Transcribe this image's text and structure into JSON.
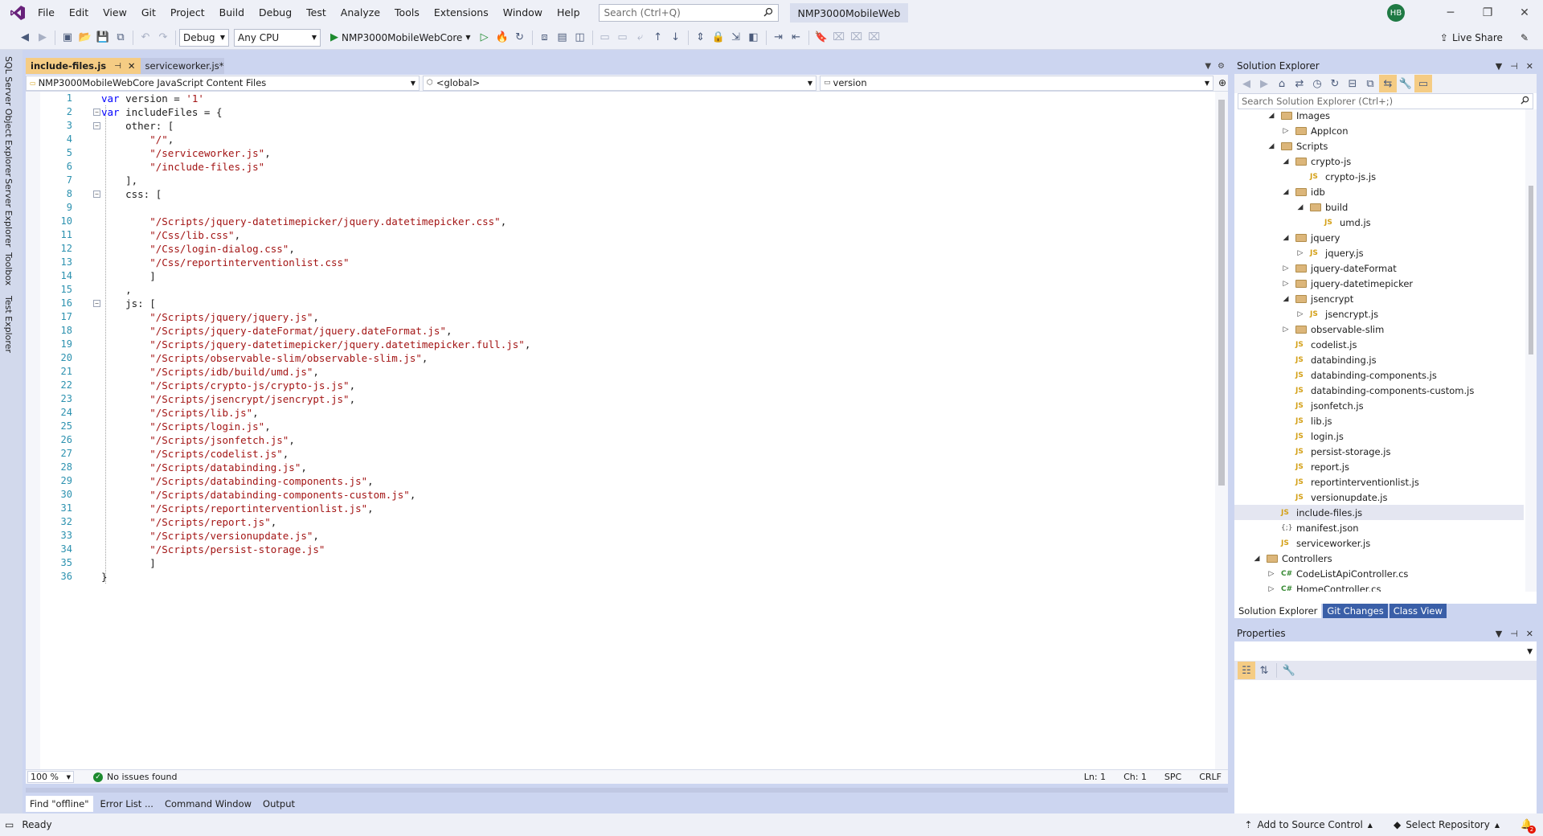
{
  "app": {
    "accent": "#68217A",
    "selected_tab_color": "#F5CC84"
  },
  "menu": {
    "items": [
      "File",
      "Edit",
      "View",
      "Git",
      "Project",
      "Build",
      "Debug",
      "Test",
      "Analyze",
      "Tools",
      "Extensions",
      "Window",
      "Help"
    ],
    "search_placeholder": "Search (Ctrl+Q)",
    "solution_name": "NMP3000MobileWeb",
    "user_initials": "HB"
  },
  "toolbar": {
    "configuration": "Debug",
    "platform": "Any CPU",
    "startup_project": "NMP3000MobileWebCore",
    "live_share": "Live Share"
  },
  "left_strip": {
    "tabs": [
      "SQL Server Object Explorer",
      "Server Explorer",
      "Toolbox",
      "Test Explorer"
    ]
  },
  "editor": {
    "tabs": [
      {
        "label": "include-files.js",
        "active": true
      },
      {
        "label": "serviceworker.js*",
        "active": false
      }
    ],
    "nav": {
      "project": "NMP3000MobileWebCore JavaScript Content Files",
      "scope": "<global>",
      "member": "version"
    },
    "lines": [
      {
        "n": "1",
        "tokens": [
          {
            "t": "var",
            "c": "kw"
          },
          {
            "t": " version = ",
            "c": "plain"
          },
          {
            "t": "'1'",
            "c": "str"
          }
        ]
      },
      {
        "n": "2",
        "fold": "−",
        "tokens": [
          {
            "t": "var",
            "c": "kw"
          },
          {
            "t": " includeFiles = {",
            "c": "plain"
          }
        ]
      },
      {
        "n": "3",
        "fold": "−",
        "tokens": [
          {
            "t": "    other: [",
            "c": "plain"
          }
        ]
      },
      {
        "n": "4",
        "tokens": [
          {
            "t": "        ",
            "c": "plain"
          },
          {
            "t": "\"/\"",
            "c": "str"
          },
          {
            "t": ",",
            "c": "plain"
          }
        ]
      },
      {
        "n": "5",
        "tokens": [
          {
            "t": "        ",
            "c": "plain"
          },
          {
            "t": "\"/serviceworker.js\"",
            "c": "str"
          },
          {
            "t": ",",
            "c": "plain"
          }
        ]
      },
      {
        "n": "6",
        "tokens": [
          {
            "t": "        ",
            "c": "plain"
          },
          {
            "t": "\"/include-files.js\"",
            "c": "str"
          }
        ]
      },
      {
        "n": "7",
        "tokens": [
          {
            "t": "    ],",
            "c": "plain"
          }
        ]
      },
      {
        "n": "8",
        "fold": "−",
        "tokens": [
          {
            "t": "    css: [",
            "c": "plain"
          }
        ]
      },
      {
        "n": "9",
        "tokens": []
      },
      {
        "n": "10",
        "tokens": [
          {
            "t": "        ",
            "c": "plain"
          },
          {
            "t": "\"/Scripts/jquery-datetimepicker/jquery.datetimepicker.css\"",
            "c": "str"
          },
          {
            "t": ",",
            "c": "plain"
          }
        ]
      },
      {
        "n": "11",
        "tokens": [
          {
            "t": "        ",
            "c": "plain"
          },
          {
            "t": "\"/Css/lib.css\"",
            "c": "str"
          },
          {
            "t": ",",
            "c": "plain"
          }
        ]
      },
      {
        "n": "12",
        "tokens": [
          {
            "t": "        ",
            "c": "plain"
          },
          {
            "t": "\"/Css/login-dialog.css\"",
            "c": "str"
          },
          {
            "t": ",",
            "c": "plain"
          }
        ]
      },
      {
        "n": "13",
        "tokens": [
          {
            "t": "        ",
            "c": "plain"
          },
          {
            "t": "\"/Css/reportinterventionlist.css\"",
            "c": "str"
          }
        ]
      },
      {
        "n": "14",
        "tokens": [
          {
            "t": "        ]",
            "c": "plain"
          }
        ]
      },
      {
        "n": "15",
        "tokens": [
          {
            "t": "    ,",
            "c": "plain"
          }
        ]
      },
      {
        "n": "16",
        "fold": "−",
        "tokens": [
          {
            "t": "    js: [",
            "c": "plain"
          }
        ]
      },
      {
        "n": "17",
        "tokens": [
          {
            "t": "        ",
            "c": "plain"
          },
          {
            "t": "\"/Scripts/jquery/jquery.js\"",
            "c": "str"
          },
          {
            "t": ",",
            "c": "plain"
          }
        ]
      },
      {
        "n": "18",
        "tokens": [
          {
            "t": "        ",
            "c": "plain"
          },
          {
            "t": "\"/Scripts/jquery-dateFormat/jquery.dateFormat.js\"",
            "c": "str"
          },
          {
            "t": ",",
            "c": "plain"
          }
        ]
      },
      {
        "n": "19",
        "tokens": [
          {
            "t": "        ",
            "c": "plain"
          },
          {
            "t": "\"/Scripts/jquery-datetimepicker/jquery.datetimepicker.full.js\"",
            "c": "str"
          },
          {
            "t": ",",
            "c": "plain"
          }
        ]
      },
      {
        "n": "20",
        "tokens": [
          {
            "t": "        ",
            "c": "plain"
          },
          {
            "t": "\"/Scripts/observable-slim/observable-slim.js\"",
            "c": "str"
          },
          {
            "t": ",",
            "c": "plain"
          }
        ]
      },
      {
        "n": "21",
        "tokens": [
          {
            "t": "        ",
            "c": "plain"
          },
          {
            "t": "\"/Scripts/idb/build/umd.js\"",
            "c": "str"
          },
          {
            "t": ",",
            "c": "plain"
          }
        ]
      },
      {
        "n": "22",
        "tokens": [
          {
            "t": "        ",
            "c": "plain"
          },
          {
            "t": "\"/Scripts/crypto-js/crypto-js.js\"",
            "c": "str"
          },
          {
            "t": ",",
            "c": "plain"
          }
        ]
      },
      {
        "n": "23",
        "tokens": [
          {
            "t": "        ",
            "c": "plain"
          },
          {
            "t": "\"/Scripts/jsencrypt/jsencrypt.js\"",
            "c": "str"
          },
          {
            "t": ",",
            "c": "plain"
          }
        ]
      },
      {
        "n": "24",
        "tokens": [
          {
            "t": "        ",
            "c": "plain"
          },
          {
            "t": "\"/Scripts/lib.js\"",
            "c": "str"
          },
          {
            "t": ",",
            "c": "plain"
          }
        ]
      },
      {
        "n": "25",
        "tokens": [
          {
            "t": "        ",
            "c": "plain"
          },
          {
            "t": "\"/Scripts/login.js\"",
            "c": "str"
          },
          {
            "t": ",",
            "c": "plain"
          }
        ]
      },
      {
        "n": "26",
        "tokens": [
          {
            "t": "        ",
            "c": "plain"
          },
          {
            "t": "\"/Scripts/jsonfetch.js\"",
            "c": "str"
          },
          {
            "t": ",",
            "c": "plain"
          }
        ]
      },
      {
        "n": "27",
        "tokens": [
          {
            "t": "        ",
            "c": "plain"
          },
          {
            "t": "\"/Scripts/codelist.js\"",
            "c": "str"
          },
          {
            "t": ",",
            "c": "plain"
          }
        ]
      },
      {
        "n": "28",
        "tokens": [
          {
            "t": "        ",
            "c": "plain"
          },
          {
            "t": "\"/Scripts/databinding.js\"",
            "c": "str"
          },
          {
            "t": ",",
            "c": "plain"
          }
        ]
      },
      {
        "n": "29",
        "tokens": [
          {
            "t": "        ",
            "c": "plain"
          },
          {
            "t": "\"/Scripts/databinding-components.js\"",
            "c": "str"
          },
          {
            "t": ",",
            "c": "plain"
          }
        ]
      },
      {
        "n": "30",
        "tokens": [
          {
            "t": "        ",
            "c": "plain"
          },
          {
            "t": "\"/Scripts/databinding-components-custom.js\"",
            "c": "str"
          },
          {
            "t": ",",
            "c": "plain"
          }
        ]
      },
      {
        "n": "31",
        "tokens": [
          {
            "t": "        ",
            "c": "plain"
          },
          {
            "t": "\"/Scripts/reportinterventionlist.js\"",
            "c": "str"
          },
          {
            "t": ",",
            "c": "plain"
          }
        ]
      },
      {
        "n": "32",
        "tokens": [
          {
            "t": "        ",
            "c": "plain"
          },
          {
            "t": "\"/Scripts/report.js\"",
            "c": "str"
          },
          {
            "t": ",",
            "c": "plain"
          }
        ]
      },
      {
        "n": "33",
        "tokens": [
          {
            "t": "        ",
            "c": "plain"
          },
          {
            "t": "\"/Scripts/versionupdate.js\"",
            "c": "str"
          },
          {
            "t": ",",
            "c": "plain"
          }
        ]
      },
      {
        "n": "34",
        "tokens": [
          {
            "t": "        ",
            "c": "plain"
          },
          {
            "t": "\"/Scripts/persist-storage.js\"",
            "c": "str"
          }
        ]
      },
      {
        "n": "35",
        "tokens": [
          {
            "t": "        ]",
            "c": "plain"
          }
        ]
      },
      {
        "n": "36",
        "tokens": [
          {
            "t": "}",
            "c": "plain"
          }
        ]
      }
    ],
    "status": {
      "zoom": "100 %",
      "issues": "No issues found",
      "line": "Ln: 1",
      "col": "Ch: 1",
      "whitespace": "SPC",
      "line_ending": "CRLF"
    }
  },
  "bottom_tabs": [
    "Find \"offline\"",
    "Error List ...",
    "Command Window",
    "Output"
  ],
  "solution_explorer": {
    "title": "Solution Explorer",
    "search_placeholder": "Search Solution Explorer (Ctrl+;)",
    "tree": [
      {
        "label": "Images",
        "icon": "folder",
        "arrow": "open",
        "level": 2
      },
      {
        "label": "AppIcon",
        "icon": "folder",
        "arrow": "closed",
        "level": 3
      },
      {
        "label": "Scripts",
        "icon": "folder",
        "arrow": "open",
        "level": 2
      },
      {
        "label": "crypto-js",
        "icon": "folder",
        "arrow": "open",
        "level": 3
      },
      {
        "label": "crypto-js.js",
        "icon": "js",
        "arrow": "",
        "level": 4
      },
      {
        "label": "idb",
        "icon": "folder",
        "arrow": "open",
        "level": 3
      },
      {
        "label": "build",
        "icon": "folder",
        "arrow": "open",
        "level": 4
      },
      {
        "label": "umd.js",
        "icon": "js",
        "arrow": "",
        "level": 5
      },
      {
        "label": "jquery",
        "icon": "folder",
        "arrow": "open",
        "level": 3
      },
      {
        "label": "jquery.js",
        "icon": "js",
        "arrow": "closed",
        "level": 4
      },
      {
        "label": "jquery-dateFormat",
        "icon": "folder",
        "arrow": "closed",
        "level": 3
      },
      {
        "label": "jquery-datetimepicker",
        "icon": "folder",
        "arrow": "closed",
        "level": 3
      },
      {
        "label": "jsencrypt",
        "icon": "folder",
        "arrow": "open",
        "level": 3
      },
      {
        "label": "jsencrypt.js",
        "icon": "js",
        "arrow": "closed",
        "level": 4
      },
      {
        "label": "observable-slim",
        "icon": "folder",
        "arrow": "closed",
        "level": 3
      },
      {
        "label": "codelist.js",
        "icon": "js",
        "arrow": "",
        "level": 3
      },
      {
        "label": "databinding.js",
        "icon": "js",
        "arrow": "",
        "level": 3
      },
      {
        "label": "databinding-components.js",
        "icon": "js",
        "arrow": "",
        "level": 3
      },
      {
        "label": "databinding-components-custom.js",
        "icon": "js",
        "arrow": "",
        "level": 3
      },
      {
        "label": "jsonfetch.js",
        "icon": "js",
        "arrow": "",
        "level": 3
      },
      {
        "label": "lib.js",
        "icon": "js",
        "arrow": "",
        "level": 3
      },
      {
        "label": "login.js",
        "icon": "js",
        "arrow": "",
        "level": 3
      },
      {
        "label": "persist-storage.js",
        "icon": "js",
        "arrow": "",
        "level": 3
      },
      {
        "label": "report.js",
        "icon": "js",
        "arrow": "",
        "level": 3
      },
      {
        "label": "reportinterventionlist.js",
        "icon": "js",
        "arrow": "",
        "level": 3
      },
      {
        "label": "versionupdate.js",
        "icon": "js",
        "arrow": "",
        "level": 3
      },
      {
        "label": "include-files.js",
        "icon": "js",
        "arrow": "",
        "level": 2,
        "selected": true
      },
      {
        "label": "manifest.json",
        "icon": "json",
        "arrow": "",
        "level": 2
      },
      {
        "label": "serviceworker.js",
        "icon": "js",
        "arrow": "",
        "level": 2
      },
      {
        "label": "Controllers",
        "icon": "folder",
        "arrow": "open",
        "level": 1
      },
      {
        "label": "CodeListApiController.cs",
        "icon": "cs",
        "arrow": "closed",
        "level": 2
      },
      {
        "label": "HomeController.cs",
        "icon": "cs",
        "arrow": "closed",
        "level": 2
      }
    ],
    "bottom_tabs": [
      {
        "label": "Solution Explorer",
        "active": true
      },
      {
        "label": "Git Changes",
        "active": false
      },
      {
        "label": "Class View",
        "active": false
      }
    ]
  },
  "properties": {
    "title": "Properties"
  },
  "statusbar": {
    "ready": "Ready",
    "source_control": "Add to Source Control",
    "repository": "Select Repository",
    "notifications": "2"
  }
}
